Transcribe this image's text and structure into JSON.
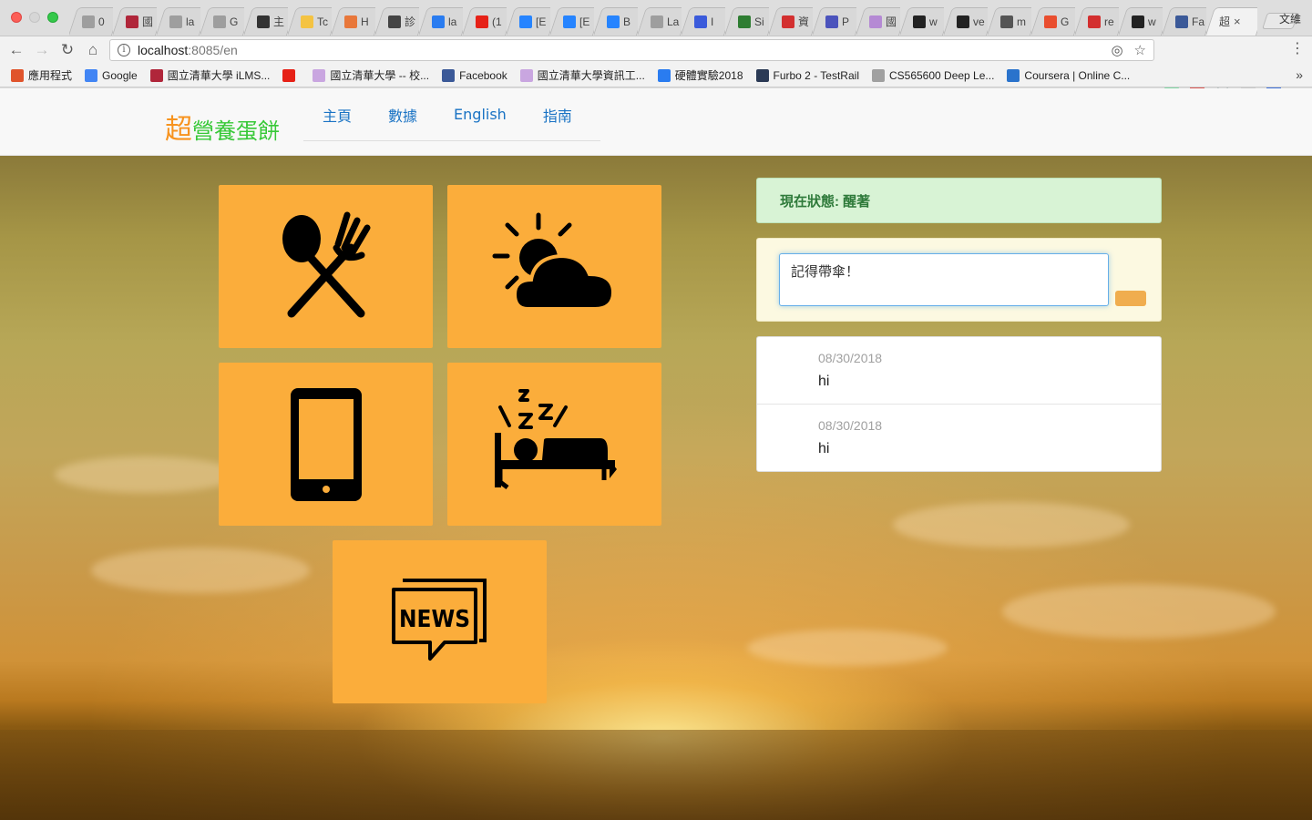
{
  "browser": {
    "user_name": "文維",
    "tabs": [
      {
        "label": "0",
        "color": "#9e9e9e"
      },
      {
        "label": "國",
        "color": "#b0263a"
      },
      {
        "label": "la",
        "color": "#9e9e9e"
      },
      {
        "label": "G",
        "color": "#9e9e9e"
      },
      {
        "label": "主",
        "color": "#333333"
      },
      {
        "label": "Tc",
        "color": "#f4c342"
      },
      {
        "label": "H",
        "color": "#e8773a"
      },
      {
        "label": "診",
        "color": "#444444"
      },
      {
        "label": "la",
        "color": "#2a7cf0"
      },
      {
        "label": "(1",
        "color": "#e62117"
      },
      {
        "label": "[E",
        "color": "#2684ff"
      },
      {
        "label": "[E",
        "color": "#2684ff"
      },
      {
        "label": "B",
        "color": "#2684ff"
      },
      {
        "label": "La",
        "color": "#9e9e9e"
      },
      {
        "label": "I",
        "color": "#3b5bdb"
      },
      {
        "label": "Si",
        "color": "#2e7d32"
      },
      {
        "label": "資",
        "color": "#d32f2f"
      },
      {
        "label": "P",
        "color": "#4b53bc"
      },
      {
        "label": "國",
        "color": "#b58ad4"
      },
      {
        "label": "w",
        "color": "#222222"
      },
      {
        "label": "ve",
        "color": "#222222"
      },
      {
        "label": "m",
        "color": "#555555"
      },
      {
        "label": "G",
        "color": "#e94e2f"
      },
      {
        "label": "re",
        "color": "#d32f2f"
      },
      {
        "label": "w",
        "color": "#222222"
      },
      {
        "label": "Fa",
        "color": "#3b5998"
      }
    ],
    "active_tab": {
      "label": "超",
      "close": "×"
    },
    "url_host": "localhost",
    "url_path": ":8085/en",
    "bookmarks": [
      {
        "label": "應用程式",
        "color": "#e0542c"
      },
      {
        "label": "Google",
        "color": "#4285f4"
      },
      {
        "label": "國立清華大學 iLMS...",
        "color": "#b0263a"
      },
      {
        "label": "",
        "color": "#e62117"
      },
      {
        "label": "國立清華大學 -- 校...",
        "color": "#c9a6e0"
      },
      {
        "label": "Facebook",
        "color": "#3b5998"
      },
      {
        "label": "國立清華大學資訊工...",
        "color": "#c9a6e0"
      },
      {
        "label": "硬體實驗2018",
        "color": "#2a7cf0"
      },
      {
        "label": "Furbo 2 - TestRail",
        "color": "#2b3a55"
      },
      {
        "label": "CS565600 Deep Le...",
        "color": "#a0a0a0"
      },
      {
        "label": "Coursera | Online C...",
        "color": "#2a73cc"
      }
    ]
  },
  "navbar": {
    "brand_first": "超",
    "brand_rest": "營養蛋餅",
    "links": [
      "主頁",
      "數據",
      "English",
      "指南"
    ]
  },
  "tiles": [
    {
      "icon": "utensils-icon"
    },
    {
      "icon": "partly-cloudy-icon"
    },
    {
      "icon": "smartphone-icon"
    },
    {
      "icon": "sleeping-bed-icon"
    },
    {
      "icon": "news-icon"
    }
  ],
  "status": {
    "text": "現在狀態: 醒著"
  },
  "compose": {
    "value": "記得帶傘！"
  },
  "messages": [
    {
      "date": "08/30/2018",
      "text": "hi"
    },
    {
      "date": "08/30/2018",
      "text": "hi"
    }
  ],
  "colors": {
    "tile_bg": "#fbad3b",
    "status_bg": "#d8f3d5",
    "status_text": "#2e7a3a",
    "compose_bg": "#fcf9e1",
    "button_bg": "#f0ad4e",
    "link": "#1a73c4",
    "brand_orange": "#f7931e",
    "brand_green": "#37c837"
  }
}
